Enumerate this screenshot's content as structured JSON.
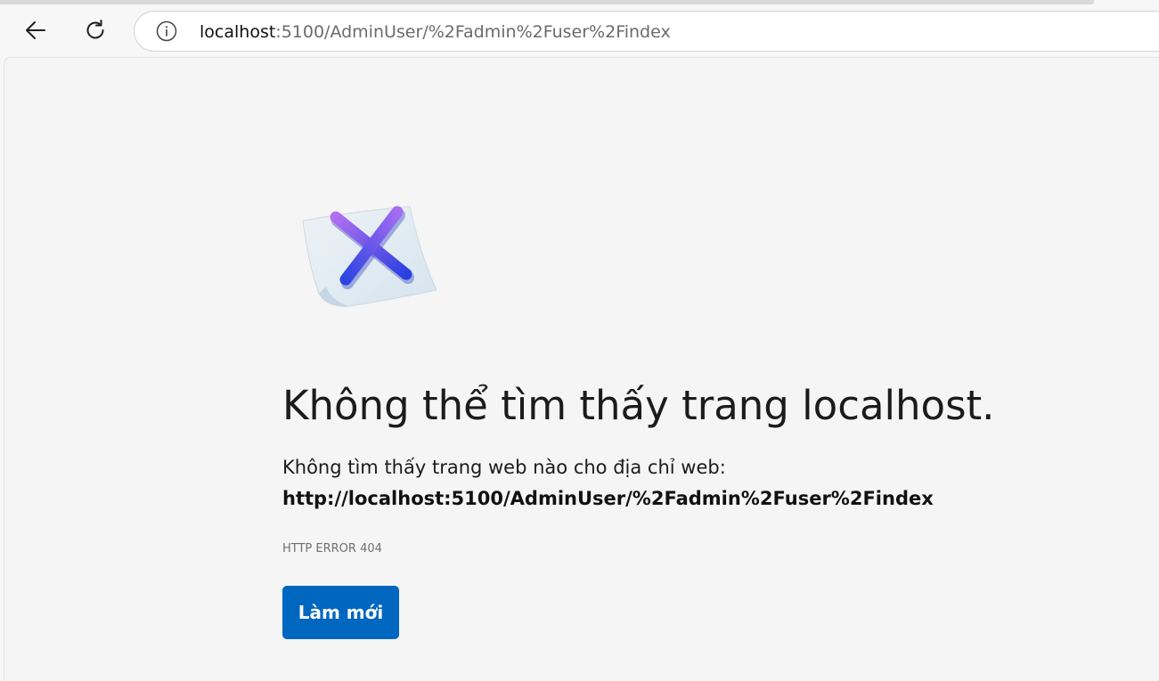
{
  "browser": {
    "address_host": "localhost",
    "address_path": ":5100/AdminUser/%2Fadmin%2Fuser%2Findex",
    "icons": {
      "back": "back-arrow-icon",
      "reload": "reload-icon",
      "info": "info-icon"
    }
  },
  "error_page": {
    "illustration": "error-x-page-icon",
    "heading": "Không thể tìm thấy trang localhost.",
    "description": "Không tìm thấy trang web nào cho địa chỉ web:",
    "url": "http://localhost:5100/AdminUser/%2Fadmin%2Fuser%2Findex",
    "error_code": "HTTP ERROR 404",
    "refresh_button": "Làm mới"
  },
  "colors": {
    "accent": "#0067c0",
    "background": "#f5f5f5"
  }
}
